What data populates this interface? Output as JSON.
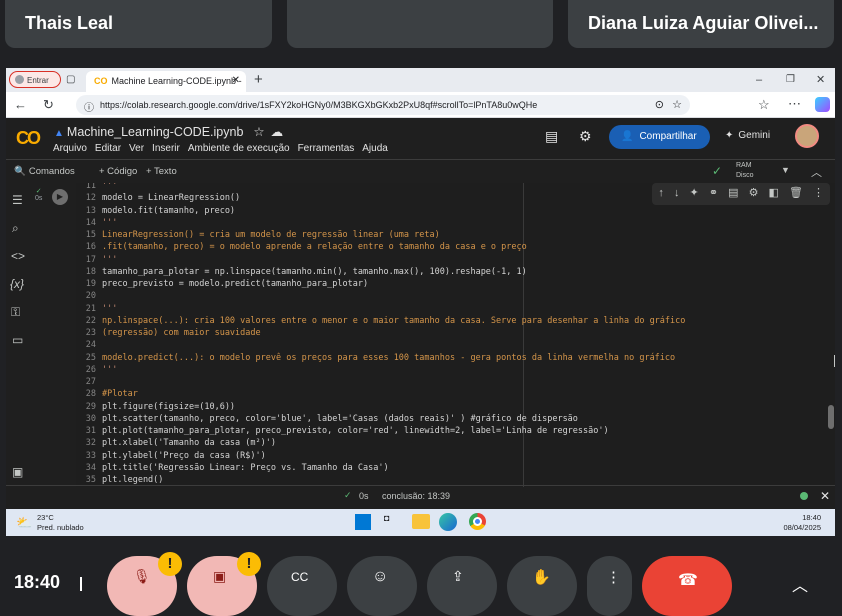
{
  "meet": {
    "participants": [
      "Thais Leal",
      "",
      "Diana Luiza Aguiar Olivei..."
    ],
    "clock": "18:40"
  },
  "browser": {
    "profile_button": "Entrar",
    "tab_title": "Machine Learning-CODE.ipynb -",
    "url": "https://colab.research.google.com/drive/1sFXY2koHGNy0/M3BKGXbGKxb2PxU8qf#scrollTo=lPnTA8u0wQHe"
  },
  "colab": {
    "notebook_title": "Machine_Learning-CODE.ipynb",
    "menu": [
      "Arquivo",
      "Editar",
      "Ver",
      "Inserir",
      "Ambiente de execução",
      "Ferramentas",
      "Ajuda"
    ],
    "share_label": "Compartilhar",
    "gemini_label": "Gemini",
    "commands_label": "Comandos",
    "add_code_label": "+ Código",
    "add_text_label": "+ Texto",
    "ram_label": "RAM",
    "disk_label": "Disco",
    "cell_exec_time": "0s",
    "status_time": "0s",
    "status_conclusion": "conclusão: 18:39"
  },
  "code_lines": [
    {
      "n": "11",
      "t": "'''",
      "c": "str"
    },
    {
      "n": "12",
      "t": "modelo = LinearRegression()",
      "c": "plain"
    },
    {
      "n": "13",
      "t": "modelo.fit(tamanho, preco)",
      "c": "plain"
    },
    {
      "n": "14",
      "t": "'''",
      "c": "str"
    },
    {
      "n": "15",
      "t": "LinearRegression() = cria um modelo de regressão linear (uma reta)",
      "c": "cm"
    },
    {
      "n": "16",
      "t": ".fit(tamanho, preco) = o modelo aprende a relação entre o tamanho da casa e o preço",
      "c": "cm"
    },
    {
      "n": "17",
      "t": "'''",
      "c": "str"
    },
    {
      "n": "18",
      "t": "tamanho_para_plotar = np.linspace(tamanho.min(), tamanho.max(), 100).reshape(-1, 1)",
      "c": "plain"
    },
    {
      "n": "19",
      "t": "preco_previsto = modelo.predict(tamanho_para_plotar)",
      "c": "plain"
    },
    {
      "n": "20",
      "t": "",
      "c": "plain"
    },
    {
      "n": "21",
      "t": "'''",
      "c": "str"
    },
    {
      "n": "22",
      "t": "np.linspace(...): cria 100 valores entre o menor e o maior tamanho da casa. Serve para desenhar a linha do gráfico",
      "c": "cm"
    },
    {
      "n": "23",
      "t": "(regressão) com maior suavidade",
      "c": "cm"
    },
    {
      "n": "24",
      "t": "",
      "c": "plain"
    },
    {
      "n": "25",
      "t": "modelo.predict(...): o modelo prevê os preços para esses 100 tamanhos - gera pontos da linha vermelha no gráfico",
      "c": "cm"
    },
    {
      "n": "26",
      "t": "'''",
      "c": "str"
    },
    {
      "n": "27",
      "t": "",
      "c": "plain"
    },
    {
      "n": "28",
      "t": "#Plotar",
      "c": "cm"
    },
    {
      "n": "29",
      "t": "plt.figure(figsize=(10,6))",
      "c": "plain"
    },
    {
      "n": "30",
      "t": "plt.scatter(tamanho, preco, color='blue', label='Casas (dados reais)' ) #gráfico de dispersão",
      "c": "plain"
    },
    {
      "n": "31",
      "t": "plt.plot(tamanho_para_plotar, preco_previsto, color='red', linewidth=2, label='Linha de regressão')",
      "c": "plain"
    },
    {
      "n": "32",
      "t": "plt.xlabel('Tamanho da casa (m²)')",
      "c": "plain"
    },
    {
      "n": "33",
      "t": "plt.ylabel('Preço da casa (R$)')",
      "c": "plain"
    },
    {
      "n": "34",
      "t": "plt.title('Regressão Linear: Preço vs. Tamanho da Casa')",
      "c": "plain"
    },
    {
      "n": "35",
      "t": "plt.legend()",
      "c": "plain"
    }
  ],
  "taskbar": {
    "weather_temp": "23°C",
    "weather_desc": "Pred. nublado",
    "time": "18:40",
    "date": "08/04/2025"
  },
  "colors": {
    "accent": "#0b57d0",
    "share_bg": "#1a5fb4",
    "meet_bg": "#202124",
    "end_call": "#ea4335",
    "warning": "#fbbc04"
  }
}
